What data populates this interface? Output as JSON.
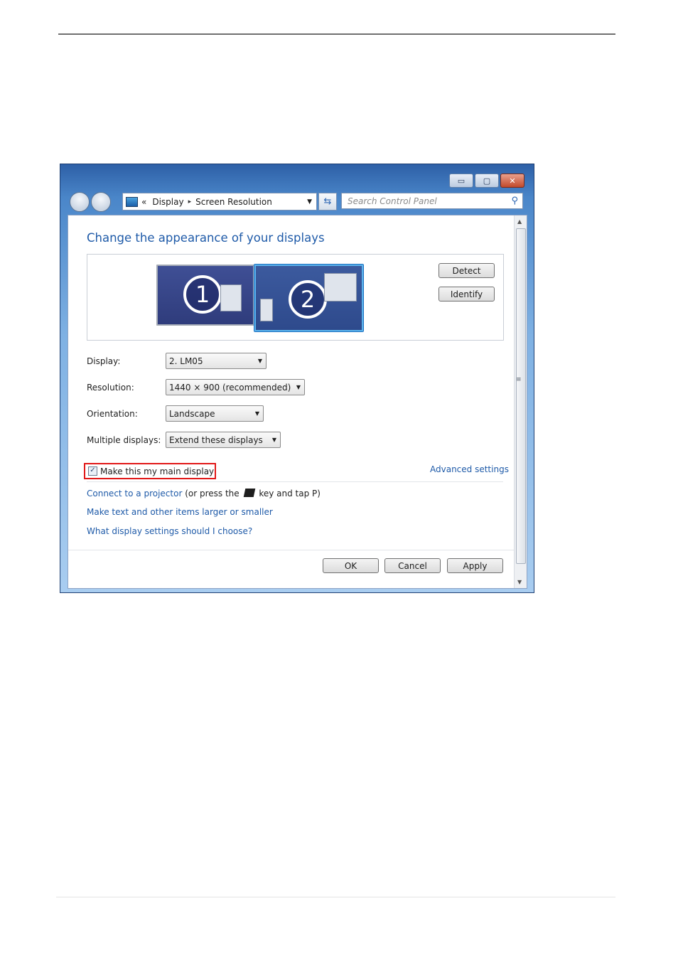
{
  "window": {
    "buttons": {
      "minimize": "▭",
      "maximize": "▢",
      "close": "✕"
    },
    "address": {
      "breadcrumb_prefix": "«",
      "crumb1": "Display",
      "separator": "▸",
      "crumb2": "Screen Resolution"
    },
    "search_placeholder": "Search Control Panel"
  },
  "content": {
    "heading": "Change the appearance of your displays",
    "monitors": [
      "1",
      "2"
    ],
    "detect_label": "Detect",
    "identify_label": "Identify",
    "fields": {
      "display_label": "Display:",
      "display_value": "2. LM05",
      "resolution_label": "Resolution:",
      "resolution_value": "1440 × 900 (recommended)",
      "orientation_label": "Orientation:",
      "orientation_value": "Landscape",
      "multiple_label": "Multiple displays:",
      "multiple_value": "Extend these displays"
    },
    "main_display_checkbox": {
      "label": "Make this my main display",
      "checked": true
    },
    "advanced_link": "Advanced settings",
    "links": {
      "projector": "Connect to a projector",
      "projector_hint_before": "(or press the",
      "projector_hint_after": "key and tap P)",
      "text_size": "Make text and other items larger or smaller",
      "help": "What display settings should I choose?"
    },
    "ok_label": "OK",
    "cancel_label": "Cancel",
    "apply_label": "Apply"
  },
  "colors": {
    "link": "#1e5aa8",
    "highlight_box": "#e11818"
  }
}
